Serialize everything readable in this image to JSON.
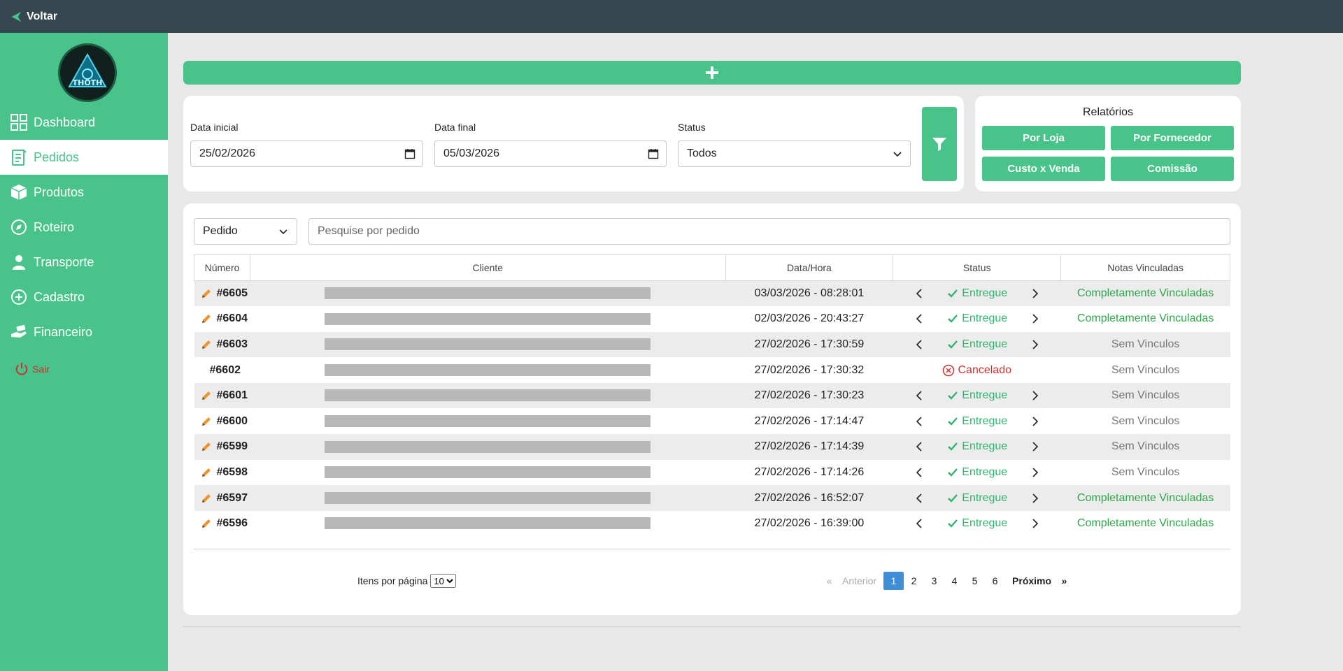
{
  "topbar": {
    "back_label": "Voltar"
  },
  "sidebar": {
    "logo_text": "THOTH",
    "items": [
      {
        "label": "Dashboard",
        "icon": "grid-icon"
      },
      {
        "label": "Pedidos",
        "icon": "document-icon",
        "active": true
      },
      {
        "label": "Produtos",
        "icon": "box-icon"
      },
      {
        "label": "Roteiro",
        "icon": "compass-icon"
      },
      {
        "label": "Transporte",
        "icon": "person-icon"
      },
      {
        "label": "Cadastro",
        "icon": "plus-circle-icon"
      },
      {
        "label": "Financeiro",
        "icon": "money-hand-icon"
      }
    ],
    "logout_label": "Sair"
  },
  "filters": {
    "start_label": "Data inicial",
    "start_value": "25/02/2026",
    "end_label": "Data final",
    "end_value": "05/03/2026",
    "status_label": "Status",
    "status_value": "Todos"
  },
  "reports": {
    "title": "Relatórios",
    "buttons": [
      "Por Loja",
      "Por Fornecedor",
      "Custo x Venda",
      "Comissão"
    ]
  },
  "search": {
    "type_value": "Pedido",
    "placeholder": "Pesquise por pedido"
  },
  "table": {
    "headers": [
      "Número",
      "Cliente",
      "Data/Hora",
      "Status",
      "Notas Vinculadas"
    ],
    "rows": [
      {
        "number": "#6605",
        "datetime": "03/03/2026 - 08:28:01",
        "status": "Entregue",
        "notes": "Completamente Vinculadas",
        "editable": true
      },
      {
        "number": "#6604",
        "datetime": "02/03/2026 - 20:43:27",
        "status": "Entregue",
        "notes": "Completamente Vinculadas",
        "editable": true
      },
      {
        "number": "#6603",
        "datetime": "27/02/2026 - 17:30:59",
        "status": "Entregue",
        "notes": "Sem Vinculos",
        "editable": true
      },
      {
        "number": "#6602",
        "datetime": "27/02/2026 - 17:30:32",
        "status": "Cancelado",
        "notes": "Sem Vinculos",
        "editable": false
      },
      {
        "number": "#6601",
        "datetime": "27/02/2026 - 17:30:23",
        "status": "Entregue",
        "notes": "Sem Vinculos",
        "editable": true
      },
      {
        "number": "#6600",
        "datetime": "27/02/2026 - 17:14:47",
        "status": "Entregue",
        "notes": "Sem Vinculos",
        "editable": true
      },
      {
        "number": "#6599",
        "datetime": "27/02/2026 - 17:14:39",
        "status": "Entregue",
        "notes": "Sem Vinculos",
        "editable": true
      },
      {
        "number": "#6598",
        "datetime": "27/02/2026 - 17:14:26",
        "status": "Entregue",
        "notes": "Sem Vinculos",
        "editable": true
      },
      {
        "number": "#6597",
        "datetime": "27/02/2026 - 16:52:07",
        "status": "Entregue",
        "notes": "Completamente Vinculadas",
        "editable": true
      },
      {
        "number": "#6596",
        "datetime": "27/02/2026 - 16:39:00",
        "status": "Entregue",
        "notes": "Completamente Vinculadas",
        "editable": true
      }
    ]
  },
  "pagination": {
    "per_page_label": "Itens por página",
    "per_page_value": "10",
    "prev_arrow": "«",
    "prev_label": "Anterior",
    "pages": [
      "1",
      "2",
      "3",
      "4",
      "5",
      "6"
    ],
    "current_page": "1",
    "next_label": "Próximo",
    "next_arrow": "»"
  },
  "colors": {
    "brand_green": "#48c38a",
    "topbar": "#37474f",
    "status_ok": "#2fb56f",
    "status_cancel": "#d32f2f",
    "page_active": "#3e8ed8"
  }
}
